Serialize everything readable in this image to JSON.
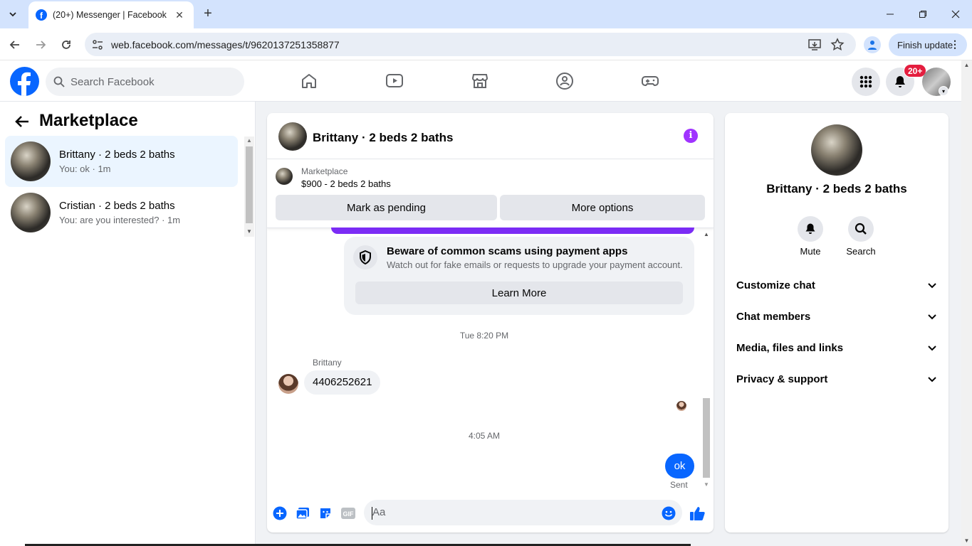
{
  "browser": {
    "tab_title": "(20+) Messenger | Facebook",
    "url": "web.facebook.com/messages/t/9620137251358877",
    "finish_update": "Finish update"
  },
  "header": {
    "search_placeholder": "Search Facebook",
    "notification_badge": "20+",
    "nav_icons": [
      "home-icon",
      "video-icon",
      "marketplace-icon",
      "groups-icon",
      "gaming-icon"
    ]
  },
  "sidebar": {
    "title": "Marketplace",
    "conversations": [
      {
        "name": "Brittany · 2 beds 2 baths",
        "preview": "You: ok · 1m",
        "active": true
      },
      {
        "name": "Cristian · 2 beds 2 baths",
        "preview": "You: are you interested? · 1m",
        "active": false
      }
    ]
  },
  "chat": {
    "title": "Brittany · 2 beds 2 baths",
    "marketplace_label": "Marketplace",
    "listing": "$900 - 2 beds 2 baths",
    "mark_pending": "Mark as pending",
    "more_options": "More options",
    "scam_title": "Beware of common scams using payment apps",
    "scam_text": "Watch out for fake emails or requests to upgrade your payment account.",
    "learn_more": "Learn More",
    "timestamp1": "Tue 8:20 PM",
    "sender_name": "Brittany",
    "incoming_message": "4406252621",
    "timestamp2": "4:05 AM",
    "outgoing_message": "ok",
    "status": "Sent",
    "input_placeholder": "Aa"
  },
  "details": {
    "name": "Brittany · 2 beds 2 baths",
    "actions": [
      {
        "label": "Mute",
        "icon": "bell-icon"
      },
      {
        "label": "Search",
        "icon": "search-icon"
      }
    ],
    "sections": [
      "Customize chat",
      "Chat members",
      "Media, files and links",
      "Privacy & support"
    ]
  },
  "colors": {
    "brand": "#0866ff",
    "accent": "#a033ff",
    "badge": "#e41e3f"
  }
}
